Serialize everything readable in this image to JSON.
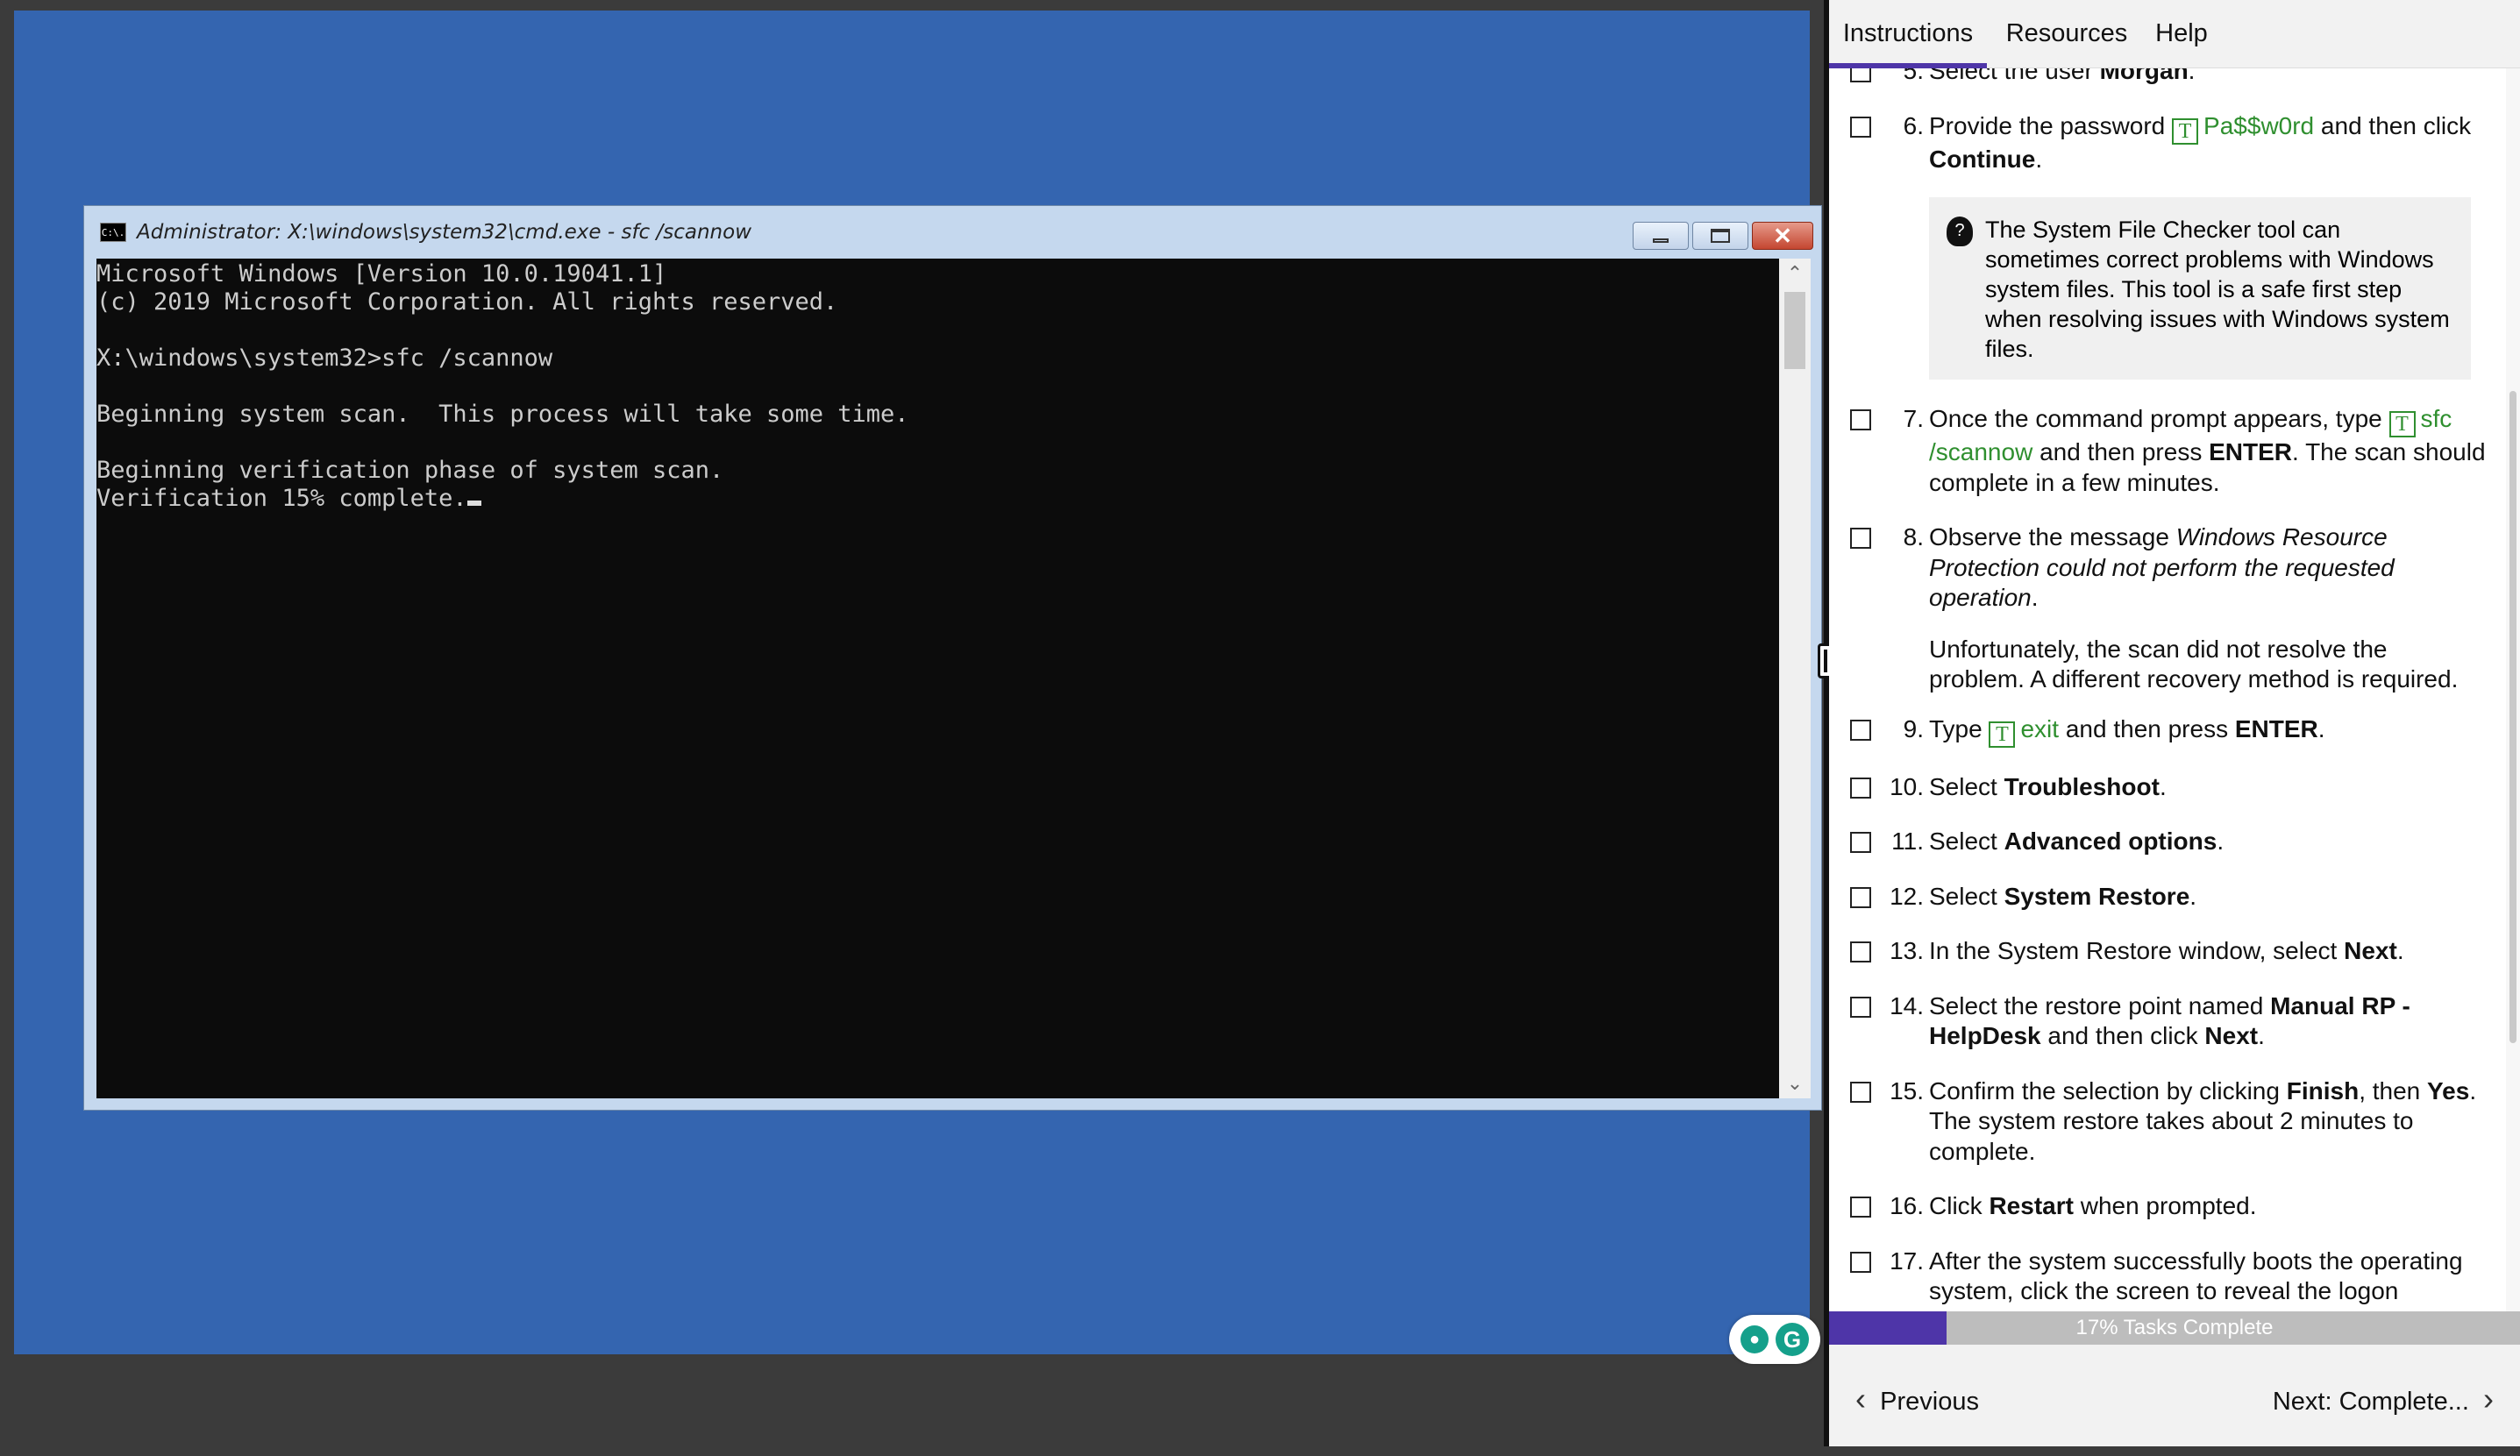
{
  "vm": {
    "cmd": {
      "title": "Administrator: X:\\windows\\system32\\cmd.exe - sfc  /scannow",
      "icon_label": "C:\\.",
      "lines": [
        "Microsoft Windows [Version 10.0.19041.1]",
        "(c) 2019 Microsoft Corporation. All rights reserved.",
        "",
        "X:\\windows\\system32>sfc /scannow",
        "",
        "Beginning system scan.  This process will take some time.",
        "",
        "Beginning verification phase of system scan.",
        "Verification 15% complete."
      ]
    },
    "icons": {
      "grammarly_bulb": "lightbulb-icon",
      "grammarly_logo": "grammarly-icon"
    }
  },
  "panel": {
    "tabs": {
      "instructions": "Instructions",
      "resources": "Resources",
      "help": "Help"
    },
    "steps": {
      "s5": {
        "num": "5.",
        "a": "Select the user ",
        "b": "Morgan",
        "c": "."
      },
      "s6": {
        "num": "6.",
        "a": "Provide the password ",
        "typed": "Pa$$w0rd",
        "b": " and then click ",
        "c": "Continue",
        "d": "."
      },
      "note": "The System File Checker tool can sometimes correct problems with Windows system files. This tool is a safe first step when resolving issues with Windows system files.",
      "s7": {
        "num": "7.",
        "a": "Once the command prompt appears, type ",
        "typed": "sfc /scannow",
        "b": " and then press ",
        "c": "ENTER",
        "d": ". The scan should complete in a few minutes."
      },
      "s8": {
        "num": "8.",
        "a": "Observe the message ",
        "b": "Windows Resource Protection could not perform the requested operation",
        "c": ".",
        "p2": "Unfortunately, the scan did not resolve the problem. A different recovery method is required."
      },
      "s9": {
        "num": "9.",
        "a": "Type ",
        "typed": "exit",
        "b": " and then press ",
        "c": "ENTER",
        "d": "."
      },
      "s10": {
        "num": "10.",
        "a": "Select ",
        "b": "Troubleshoot",
        "c": "."
      },
      "s11": {
        "num": "11.",
        "a": "Select ",
        "b": "Advanced options",
        "c": "."
      },
      "s12": {
        "num": "12.",
        "a": "Select ",
        "b": "System Restore",
        "c": "."
      },
      "s13": {
        "num": "13.",
        "a": "In the System Restore window, select ",
        "b": "Next",
        "c": "."
      },
      "s14": {
        "num": "14.",
        "a": "Select the restore point named ",
        "b": "Manual RP - HelpDesk",
        "c": " and then click ",
        "d": "Next",
        "e": "."
      },
      "s15": {
        "num": "15.",
        "a": "Confirm the selection by clicking ",
        "b": "Finish",
        "c": ", then ",
        "d": "Yes",
        "e": ". The system restore takes about 2 minutes to complete."
      },
      "s16": {
        "num": "16.",
        "a": "Click ",
        "b": "Restart",
        "c": " when prompted."
      },
      "s17": {
        "num": "17.",
        "a": "After the system successfully boots the operating system, click the screen to reveal the logon"
      }
    },
    "typed_icon": "T",
    "progress": {
      "label": "17% Tasks Complete",
      "fraction": 0.17
    },
    "nav": {
      "previous": "Previous",
      "next": "Next: Complete..."
    }
  }
}
